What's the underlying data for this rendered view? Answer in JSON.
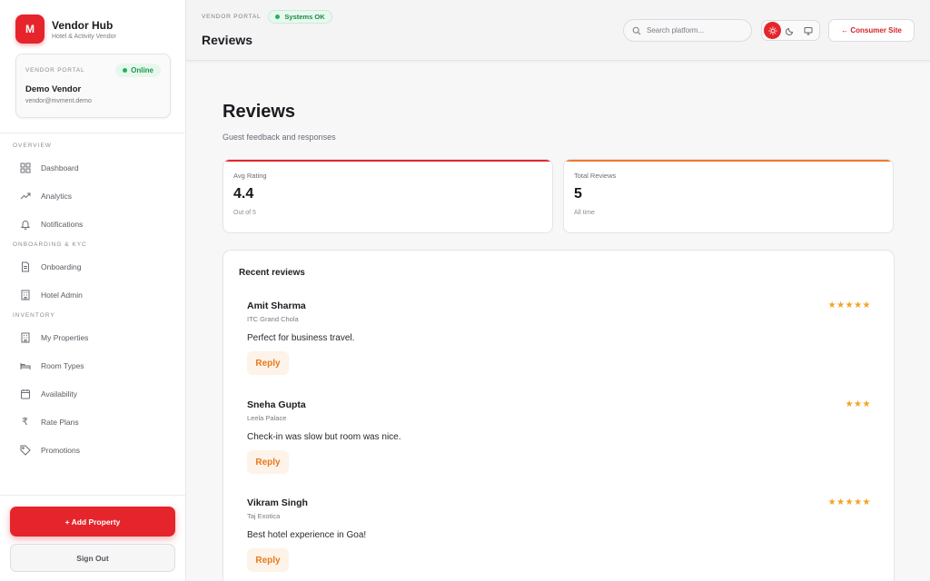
{
  "brand": {
    "initial": "M",
    "name": "Vendor Hub",
    "subtitle": "Hotel & Activity Vendor"
  },
  "vendor_card": {
    "label": "Vendor Portal",
    "status": "Online",
    "name": "Demo Vendor",
    "email": "vendor@mvment.demo"
  },
  "nav": {
    "sections": [
      {
        "title": "Overview",
        "items": [
          {
            "label": "Dashboard",
            "icon": "grid-icon"
          },
          {
            "label": "Analytics",
            "icon": "trend-icon"
          },
          {
            "label": "Notifications",
            "icon": "bell-icon"
          }
        ]
      },
      {
        "title": "Onboarding & KYC",
        "items": [
          {
            "label": "Onboarding",
            "icon": "document-icon"
          },
          {
            "label": "Hotel Admin",
            "icon": "building-icon"
          }
        ]
      },
      {
        "title": "Inventory",
        "items": [
          {
            "label": "My Properties",
            "icon": "building-icon"
          },
          {
            "label": "Room Types",
            "icon": "bed-icon"
          },
          {
            "label": "Availability",
            "icon": "calendar-icon"
          },
          {
            "label": "Rate Plans",
            "icon": "rupee-icon"
          },
          {
            "label": "Promotions",
            "icon": "tag-icon"
          }
        ]
      }
    ]
  },
  "sidebar_actions": {
    "add_property": "+ Add Property",
    "sign_out": "Sign Out"
  },
  "header": {
    "portal_label": "Vendor Portal",
    "status": "Systems OK",
    "title": "Reviews",
    "search_placeholder": "Search platform...",
    "consumer_site": "← Consumer Site"
  },
  "page": {
    "title": "Reviews",
    "subtitle": "Guest feedback and responses"
  },
  "stats": [
    {
      "label": "Avg Rating",
      "value": "4.4",
      "note": "Out of 5"
    },
    {
      "label": "Total Reviews",
      "value": "5",
      "note": "All time"
    }
  ],
  "recent_reviews": {
    "title": "Recent reviews",
    "reply_label": "Reply",
    "items": [
      {
        "name": "Amit Sharma",
        "property": "ITC Grand Chola",
        "text": "Perfect for business travel.",
        "rating": 5
      },
      {
        "name": "Sneha Gupta",
        "property": "Leela Palace",
        "text": "Check-in was slow but room was nice.",
        "rating": 3
      },
      {
        "name": "Vikram Singh",
        "property": "Taj Exotica",
        "text": "Best hotel experience in Goa!",
        "rating": 5
      }
    ]
  },
  "colors": {
    "accent": "#e5252b",
    "accent_orange": "#ef7a2a",
    "star": "#f2a320",
    "success": "#22b35a"
  }
}
